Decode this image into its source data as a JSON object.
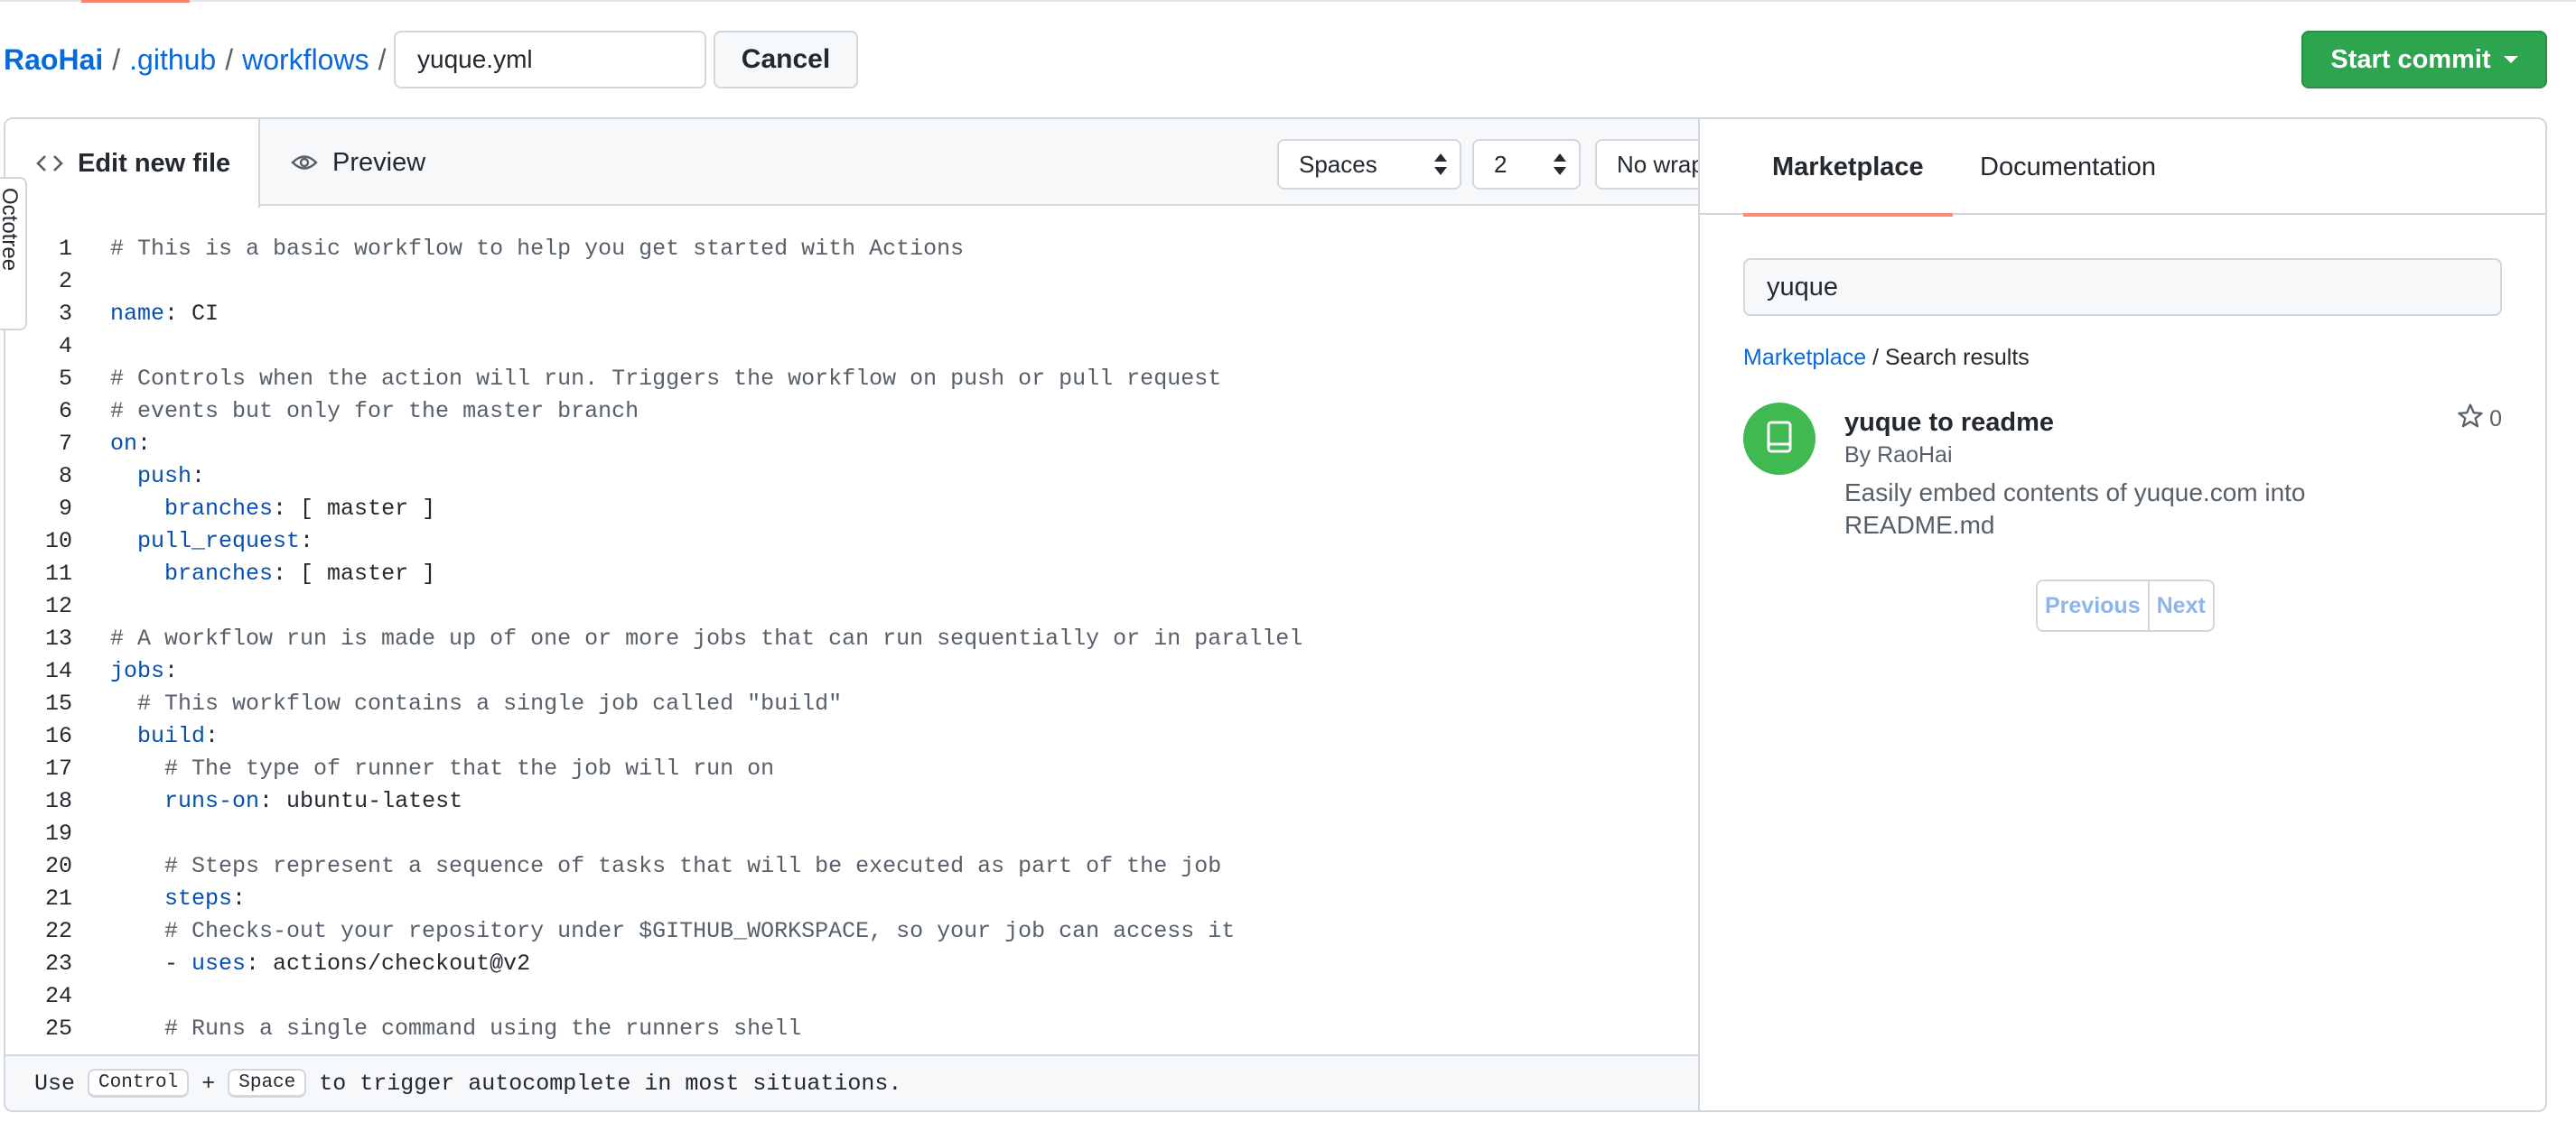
{
  "breadcrumb": {
    "owner": "RaoHai",
    "sep": "/",
    "parts": [
      ".github",
      "workflows"
    ]
  },
  "filename": {
    "value": "yuque.yml"
  },
  "buttons": {
    "cancel": "Cancel",
    "start_commit": "Start commit"
  },
  "editor": {
    "tabs": {
      "edit": "Edit new file",
      "preview": "Preview"
    },
    "indent_mode": "Spaces",
    "indent_size": "2",
    "wrap_mode": "No wrap",
    "lines": [
      {
        "n": "1",
        "parts": [
          {
            "t": "# This is a basic workflow to help you get started with Actions",
            "c": "com"
          }
        ]
      },
      {
        "n": "2",
        "parts": []
      },
      {
        "n": "3",
        "parts": [
          {
            "t": "name",
            "c": "key"
          },
          {
            "t": ": CI",
            "c": ""
          }
        ]
      },
      {
        "n": "4",
        "parts": []
      },
      {
        "n": "5",
        "parts": [
          {
            "t": "# Controls when the action will run. Triggers the workflow on push or pull request",
            "c": "com"
          }
        ]
      },
      {
        "n": "6",
        "parts": [
          {
            "t": "# events but only for the master branch",
            "c": "com"
          }
        ]
      },
      {
        "n": "7",
        "parts": [
          {
            "t": "on",
            "c": "key"
          },
          {
            "t": ":",
            "c": ""
          }
        ]
      },
      {
        "n": "8",
        "parts": [
          {
            "t": "  ",
            "c": ""
          },
          {
            "t": "push",
            "c": "key"
          },
          {
            "t": ":",
            "c": ""
          }
        ]
      },
      {
        "n": "9",
        "parts": [
          {
            "t": "    ",
            "c": ""
          },
          {
            "t": "branches",
            "c": "key"
          },
          {
            "t": ": [ master ]",
            "c": ""
          }
        ]
      },
      {
        "n": "10",
        "parts": [
          {
            "t": "  ",
            "c": ""
          },
          {
            "t": "pull_request",
            "c": "key"
          },
          {
            "t": ":",
            "c": ""
          }
        ]
      },
      {
        "n": "11",
        "parts": [
          {
            "t": "    ",
            "c": ""
          },
          {
            "t": "branches",
            "c": "key"
          },
          {
            "t": ": [ master ]",
            "c": ""
          }
        ]
      },
      {
        "n": "12",
        "parts": []
      },
      {
        "n": "13",
        "parts": [
          {
            "t": "# A workflow run is made up of one or more jobs that can run sequentially or in parallel",
            "c": "com"
          }
        ]
      },
      {
        "n": "14",
        "parts": [
          {
            "t": "jobs",
            "c": "key"
          },
          {
            "t": ":",
            "c": ""
          }
        ]
      },
      {
        "n": "15",
        "parts": [
          {
            "t": "  # This workflow contains a single job called \"build\"",
            "c": "com"
          }
        ]
      },
      {
        "n": "16",
        "parts": [
          {
            "t": "  ",
            "c": ""
          },
          {
            "t": "build",
            "c": "key"
          },
          {
            "t": ":",
            "c": ""
          }
        ]
      },
      {
        "n": "17",
        "parts": [
          {
            "t": "    # The type of runner that the job will run on",
            "c": "com"
          }
        ]
      },
      {
        "n": "18",
        "parts": [
          {
            "t": "    ",
            "c": ""
          },
          {
            "t": "runs-on",
            "c": "key"
          },
          {
            "t": ": ubuntu-latest",
            "c": ""
          }
        ]
      },
      {
        "n": "19",
        "parts": []
      },
      {
        "n": "20",
        "parts": [
          {
            "t": "    # Steps represent a sequence of tasks that will be executed as part of the job",
            "c": "com"
          }
        ]
      },
      {
        "n": "21",
        "parts": [
          {
            "t": "    ",
            "c": ""
          },
          {
            "t": "steps",
            "c": "key"
          },
          {
            "t": ":",
            "c": ""
          }
        ]
      },
      {
        "n": "22",
        "parts": [
          {
            "t": "    # Checks-out your repository under $GITHUB_WORKSPACE, so your job can access it",
            "c": "com"
          }
        ]
      },
      {
        "n": "23",
        "parts": [
          {
            "t": "    - ",
            "c": ""
          },
          {
            "t": "uses",
            "c": "key"
          },
          {
            "t": ": actions/checkout@v2",
            "c": ""
          }
        ]
      },
      {
        "n": "24",
        "parts": []
      },
      {
        "n": "25",
        "parts": [
          {
            "t": "    # Runs a single command using the runners shell",
            "c": "com"
          }
        ]
      }
    ],
    "footer": {
      "pre": "Use",
      "key1": "Control",
      "plus": "+",
      "key2": "Space",
      "post": "to trigger autocomplete in most situations."
    }
  },
  "octotree": {
    "label": "Octotree"
  },
  "sidebar": {
    "tabs": {
      "marketplace": "Marketplace",
      "documentation": "Documentation"
    },
    "search": {
      "value": "yuque"
    },
    "results_crumb": {
      "link": "Marketplace",
      "rest": " / Search results"
    },
    "result": {
      "title": "yuque to readme",
      "by": "By RaoHai",
      "description": "Easily embed contents of yuque.com into README.md",
      "stars": "0"
    },
    "pager": {
      "prev": "Previous",
      "next": "Next"
    }
  },
  "colors": {
    "accent": "#0969da",
    "commit": "#2da44e",
    "tab_underline": "#fd8c73",
    "avatar": "#3fb950"
  }
}
